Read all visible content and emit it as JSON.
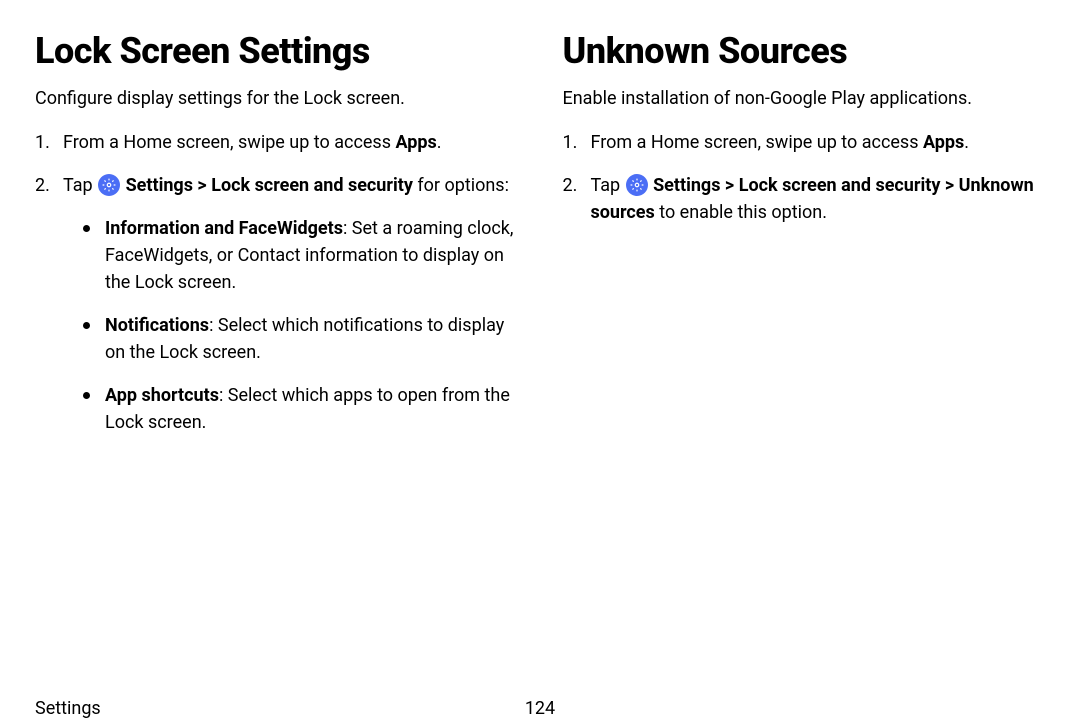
{
  "left": {
    "heading": "Lock Screen Settings",
    "intro": "Configure display settings for the Lock screen.",
    "step1_prefix": "From a Home screen, swipe up to access ",
    "step1_bold": "Apps",
    "step1_suffix": ".",
    "step2_prefix": "Tap ",
    "step2_bold": "Settings > Lock screen and security",
    "step2_suffix": " for options:",
    "bullets": [
      {
        "bold": "Information and FaceWidgets",
        "rest": ": Set a roaming clock, FaceWidgets, or Contact information to display on the Lock screen."
      },
      {
        "bold": "Notifications",
        "rest": ": Select which notifications to display on the Lock screen."
      },
      {
        "bold": "App shortcuts",
        "rest": ": Select which apps to open from the Lock screen."
      }
    ]
  },
  "right": {
    "heading": "Unknown Sources",
    "intro": "Enable installation of non-Google Play applications.",
    "step1_prefix": "From a Home screen, swipe up to access ",
    "step1_bold": "Apps",
    "step1_suffix": ".",
    "step2_prefix": "Tap ",
    "step2_bold1": "Settings > Lock screen and security > Unknown sources",
    "step2_suffix": " to enable this option."
  },
  "footer": {
    "section": "Settings",
    "page": "124"
  }
}
